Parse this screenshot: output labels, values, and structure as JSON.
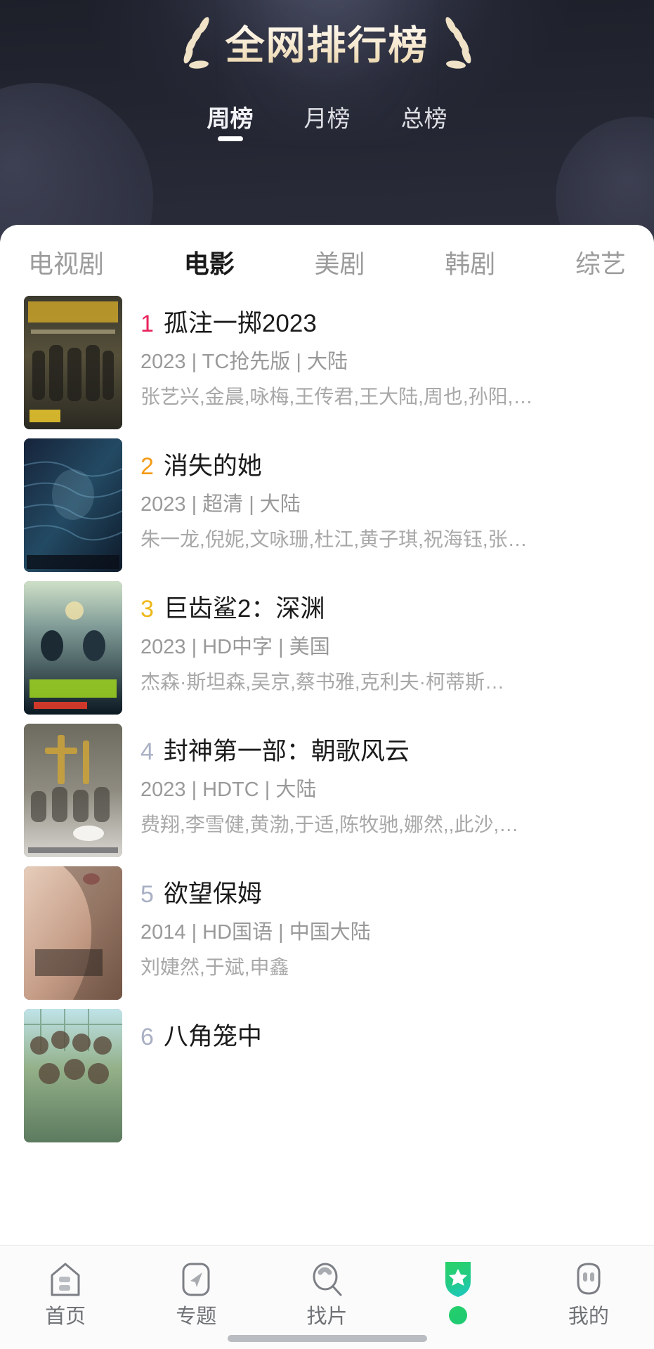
{
  "header": {
    "title": "全网排行榜",
    "left_decoration_icon": "laurel-branch-left-icon",
    "right_decoration_icon": "laurel-branch-right-icon",
    "period_tabs": [
      {
        "label": "周榜",
        "active": true
      },
      {
        "label": "月榜",
        "active": false
      },
      {
        "label": "总榜",
        "active": false
      }
    ]
  },
  "category_tabs": [
    {
      "label": "电视剧",
      "active": false
    },
    {
      "label": "电影",
      "active": true
    },
    {
      "label": "美剧",
      "active": false
    },
    {
      "label": "韩剧",
      "active": false
    },
    {
      "label": "综艺",
      "active": false
    }
  ],
  "rank_colors": {
    "rank1": "#E8245C",
    "rank2": "#F59A16",
    "rank3": "#EEB81B",
    "other": "#A9B0C4"
  },
  "ranking": [
    {
      "rank": "1",
      "title": "孤注一掷2023",
      "meta": "2023 | TC抢先版 | 大陆",
      "cast": "张艺兴,金晨,咏梅,王传君,王大陆,周也,孙阳,…",
      "poster_name": "poster-gu-zhu-yi-zhi"
    },
    {
      "rank": "2",
      "title": "消失的她",
      "meta": "2023 | 超清 | 大陆",
      "cast": "朱一龙,倪妮,文咏珊,杜江,黄子琪,祝海钰,张…",
      "poster_name": "poster-xiao-shi-de-ta"
    },
    {
      "rank": "3",
      "title": "巨齿鲨2：深渊",
      "meta": "2023 | HD中字 | 美国",
      "cast": "杰森·斯坦森,吴京,蔡书雅,克利夫·柯蒂斯…",
      "poster_name": "poster-ju-chi-sha-2"
    },
    {
      "rank": "4",
      "title": "封神第一部：朝歌风云",
      "meta": "2023 | HDTC | 大陆",
      "cast": "费翔,李雪健,黄渤,于适,陈牧驰,娜然,,此沙,…",
      "poster_name": "poster-feng-shen-1"
    },
    {
      "rank": "5",
      "title": "欲望保姆",
      "meta": "2014 | HD国语 | 中国大陆",
      "cast": "刘婕然,于斌,申鑫",
      "poster_name": "poster-yu-wang-bao-mu"
    },
    {
      "rank": "6",
      "title": "八角笼中",
      "meta": "",
      "cast": "",
      "poster_name": "poster-ba-jiao-long-zhong"
    }
  ],
  "tabbar": [
    {
      "label": "首页",
      "icon": "home-icon",
      "active": false
    },
    {
      "label": "专题",
      "icon": "compass-send-icon",
      "active": false
    },
    {
      "label": "找片",
      "icon": "search-icon",
      "active": false
    },
    {
      "label": "",
      "icon": "shield-star-icon",
      "active": true
    },
    {
      "label": "我的",
      "icon": "person-icon",
      "active": false
    }
  ]
}
